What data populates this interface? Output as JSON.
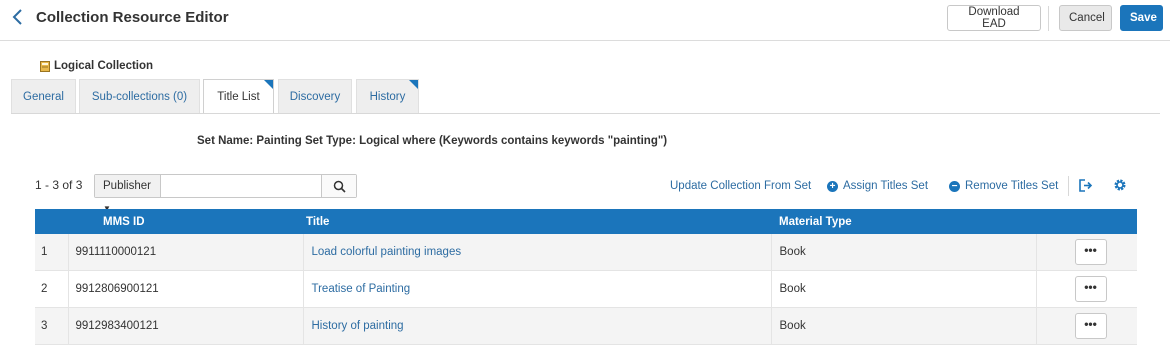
{
  "header": {
    "title": "Collection Resource Editor",
    "download_label": "Download EAD",
    "cancel_label": "Cancel",
    "save_label": "Save"
  },
  "collection": {
    "label": "Logical Collection"
  },
  "tabs": [
    {
      "label": "General"
    },
    {
      "label": "Sub-collections (0)"
    },
    {
      "label": "Title List",
      "active": true
    },
    {
      "label": "Discovery"
    },
    {
      "label": "History"
    }
  ],
  "set_info": "Set Name: Painting Set Type: Logical where (Keywords contains keywords \"painting\")",
  "list": {
    "count": "1 - 3 of 3",
    "search_scope": "Publisher",
    "search_value": "",
    "actions": {
      "update": "Update Collection From Set",
      "assign": "Assign Titles Set",
      "remove": "Remove Titles Set"
    }
  },
  "table": {
    "columns": {
      "mms_id": "MMS ID",
      "title": "Title",
      "material_type": "Material Type"
    },
    "rows": [
      {
        "num": "1",
        "mms_id": "9911110000121",
        "title": "Load colorful painting images",
        "material_type": "Book",
        "menu": "•••"
      },
      {
        "num": "2",
        "mms_id": "9912806900121",
        "title": "Treatise of Painting",
        "material_type": "Book",
        "menu": "•••"
      },
      {
        "num": "3",
        "mms_id": "9912983400121",
        "title": "History of painting",
        "material_type": "Book",
        "menu": "•••"
      }
    ]
  },
  "colors": {
    "accent": "#1b75bb",
    "link": "#2d6ca2"
  },
  "icons": [
    "back-chevron-icon",
    "collection-icon",
    "search-icon",
    "plus-circle-icon",
    "minus-circle-icon",
    "export-icon",
    "gear-icon"
  ]
}
